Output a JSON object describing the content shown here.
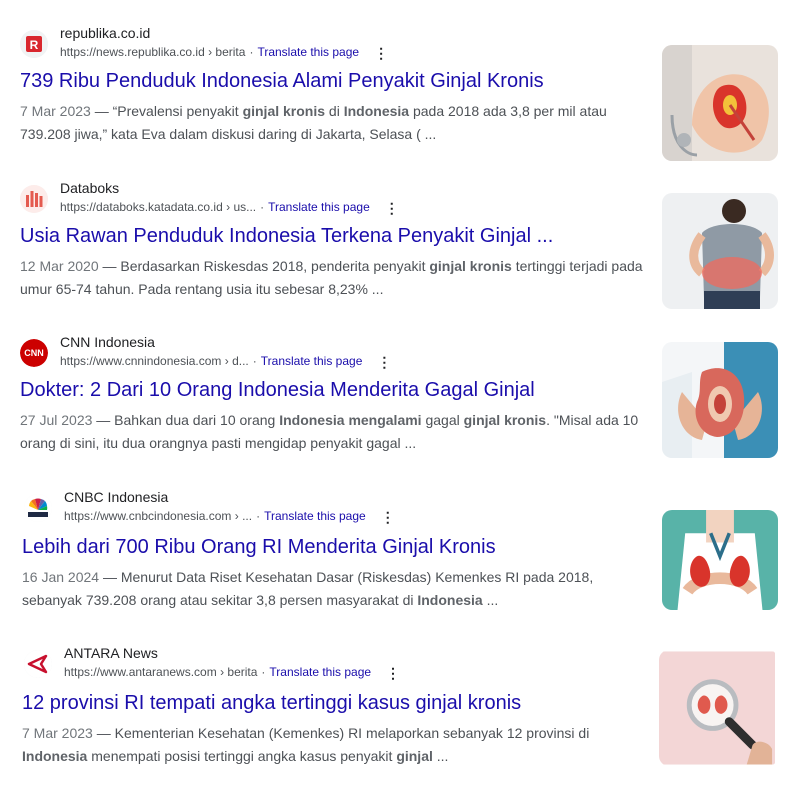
{
  "results": [
    {
      "site_name": "republika.co.id",
      "url": "https://news.republika.co.id › berita",
      "translate_label": "Translate this page",
      "title": "739 Ribu Penduduk Indonesia Alami Penyakit Ginjal Kronis",
      "snippet": {
        "date": "7 Mar 2023",
        "t1": " — “Prevalensi penyakit ",
        "b1": "ginjal kronis",
        "t2": " di ",
        "b2": "Indonesia",
        "t3": " pada 2018 ada 3,8 per mil atau 739.208 jiwa,” kata Eva dalam diskusi daring di Jakarta, Selasa ( ..."
      },
      "favicon_icon": "republika-r-logo-icon",
      "thumbnail_icon": "kidney-in-hands-icon"
    },
    {
      "site_name": "Databoks",
      "url": "https://databoks.katadata.co.id › us...",
      "translate_label": "Translate this page",
      "title": "Usia Rawan Penduduk Indonesia Terkena Penyakit Ginjal ...",
      "snippet": {
        "date": "12 Mar 2020",
        "t1": " — Berdasarkan Riskesdas 2018, penderita penyakit ",
        "b1": "ginjal kronis",
        "t2": " tertinggi terjadi pada umur 65-74 tahun. Pada rentang usia itu sebesar 8,23% ...",
        "b2": "",
        "t3": ""
      },
      "favicon_icon": "databoks-bars-icon",
      "thumbnail_icon": "back-pain-icon"
    },
    {
      "site_name": "CNN Indonesia",
      "url": "https://www.cnnindonesia.com › d...",
      "translate_label": "Translate this page",
      "title": "Dokter: 2 Dari 10 Orang Indonesia Menderita Gagal Ginjal",
      "snippet": {
        "date": "27 Jul 2023",
        "t1": " — Bahkan dua dari 10 orang ",
        "b1": "Indonesia mengalami",
        "t2": " gagal ",
        "b2": "ginjal kronis",
        "t3": ". \"Misal ada 10 orang di sini, itu dua orangnya pasti mengidap penyakit gagal  ..."
      },
      "favicon_icon": "cnn-logo-icon",
      "thumbnail_icon": "kidney-model-hands-icon"
    },
    {
      "site_name": "CNBC Indonesia",
      "url": "https://www.cnbcindonesia.com › ...",
      "translate_label": "Translate this page",
      "title": "Lebih dari 700 Ribu Orang RI Menderita Ginjal Kronis",
      "snippet": {
        "date": "16 Jan 2024",
        "t1": " — Menurut Data Riset Kesehatan Dasar (Riskesdas) Kemenkes RI pada 2018, sebanyak 739.208 orang atau sekitar 3,8 persen masyarakat di ",
        "b1": "Indonesia",
        "t2": " ...",
        "b2": "",
        "t3": ""
      },
      "favicon_icon": "cnbc-peacock-icon",
      "thumbnail_icon": "doctor-kidney-icon"
    },
    {
      "site_name": "ANTARA News",
      "url": "https://www.antaranews.com › berita",
      "translate_label": "Translate this page",
      "title": "12 provinsi RI tempati angka tertinggi kasus ginjal kronis",
      "snippet": {
        "date": "7 Mar 2023",
        "t1": " — Kementerian Kesehatan (Kemenkes) RI melaporkan sebanyak 12 provinsi di ",
        "b1": "Indonesia",
        "t2": " menempati posisi tertinggi angka kasus penyakit ",
        "b2": "ginjal",
        "t3": " ..."
      },
      "favicon_icon": "antara-logo-icon",
      "thumbnail_icon": "magnifier-kidney-icon"
    }
  ],
  "colors": {
    "link": "#1a0dab",
    "text": "#4d5156",
    "site": "#202124"
  }
}
